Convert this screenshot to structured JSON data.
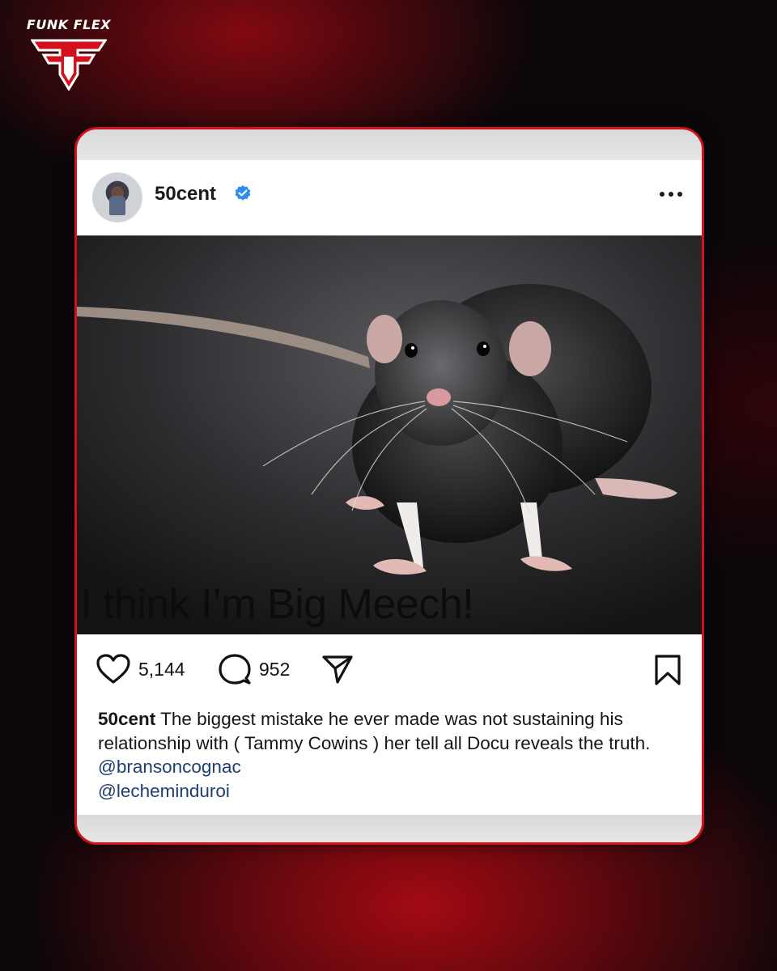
{
  "brand": {
    "name": "FUNK FLEX",
    "logo_icon": "ff-shield-logo-icon",
    "accent": "#d2111d"
  },
  "post": {
    "username": "50cent",
    "verified_icon": "verified-badge-icon",
    "more_icon": "more-options-icon",
    "image": {
      "subject": "rat-photo",
      "overlay_text": "I think I’m Big Meech!"
    },
    "actions": {
      "likes": "5,144",
      "comments": "952",
      "like_icon": "heart-icon",
      "comment_icon": "comment-bubble-icon",
      "share_icon": "send-icon",
      "save_icon": "bookmark-icon"
    },
    "caption": {
      "user": "50cent",
      "text": " The biggest mistake he ever made was not sustaining his relationship with ( Tammy Cowins ) her tell all Docu reveals the truth. ",
      "mentions": [
        "@bransoncognac",
        "@lecheminduroi"
      ]
    }
  }
}
